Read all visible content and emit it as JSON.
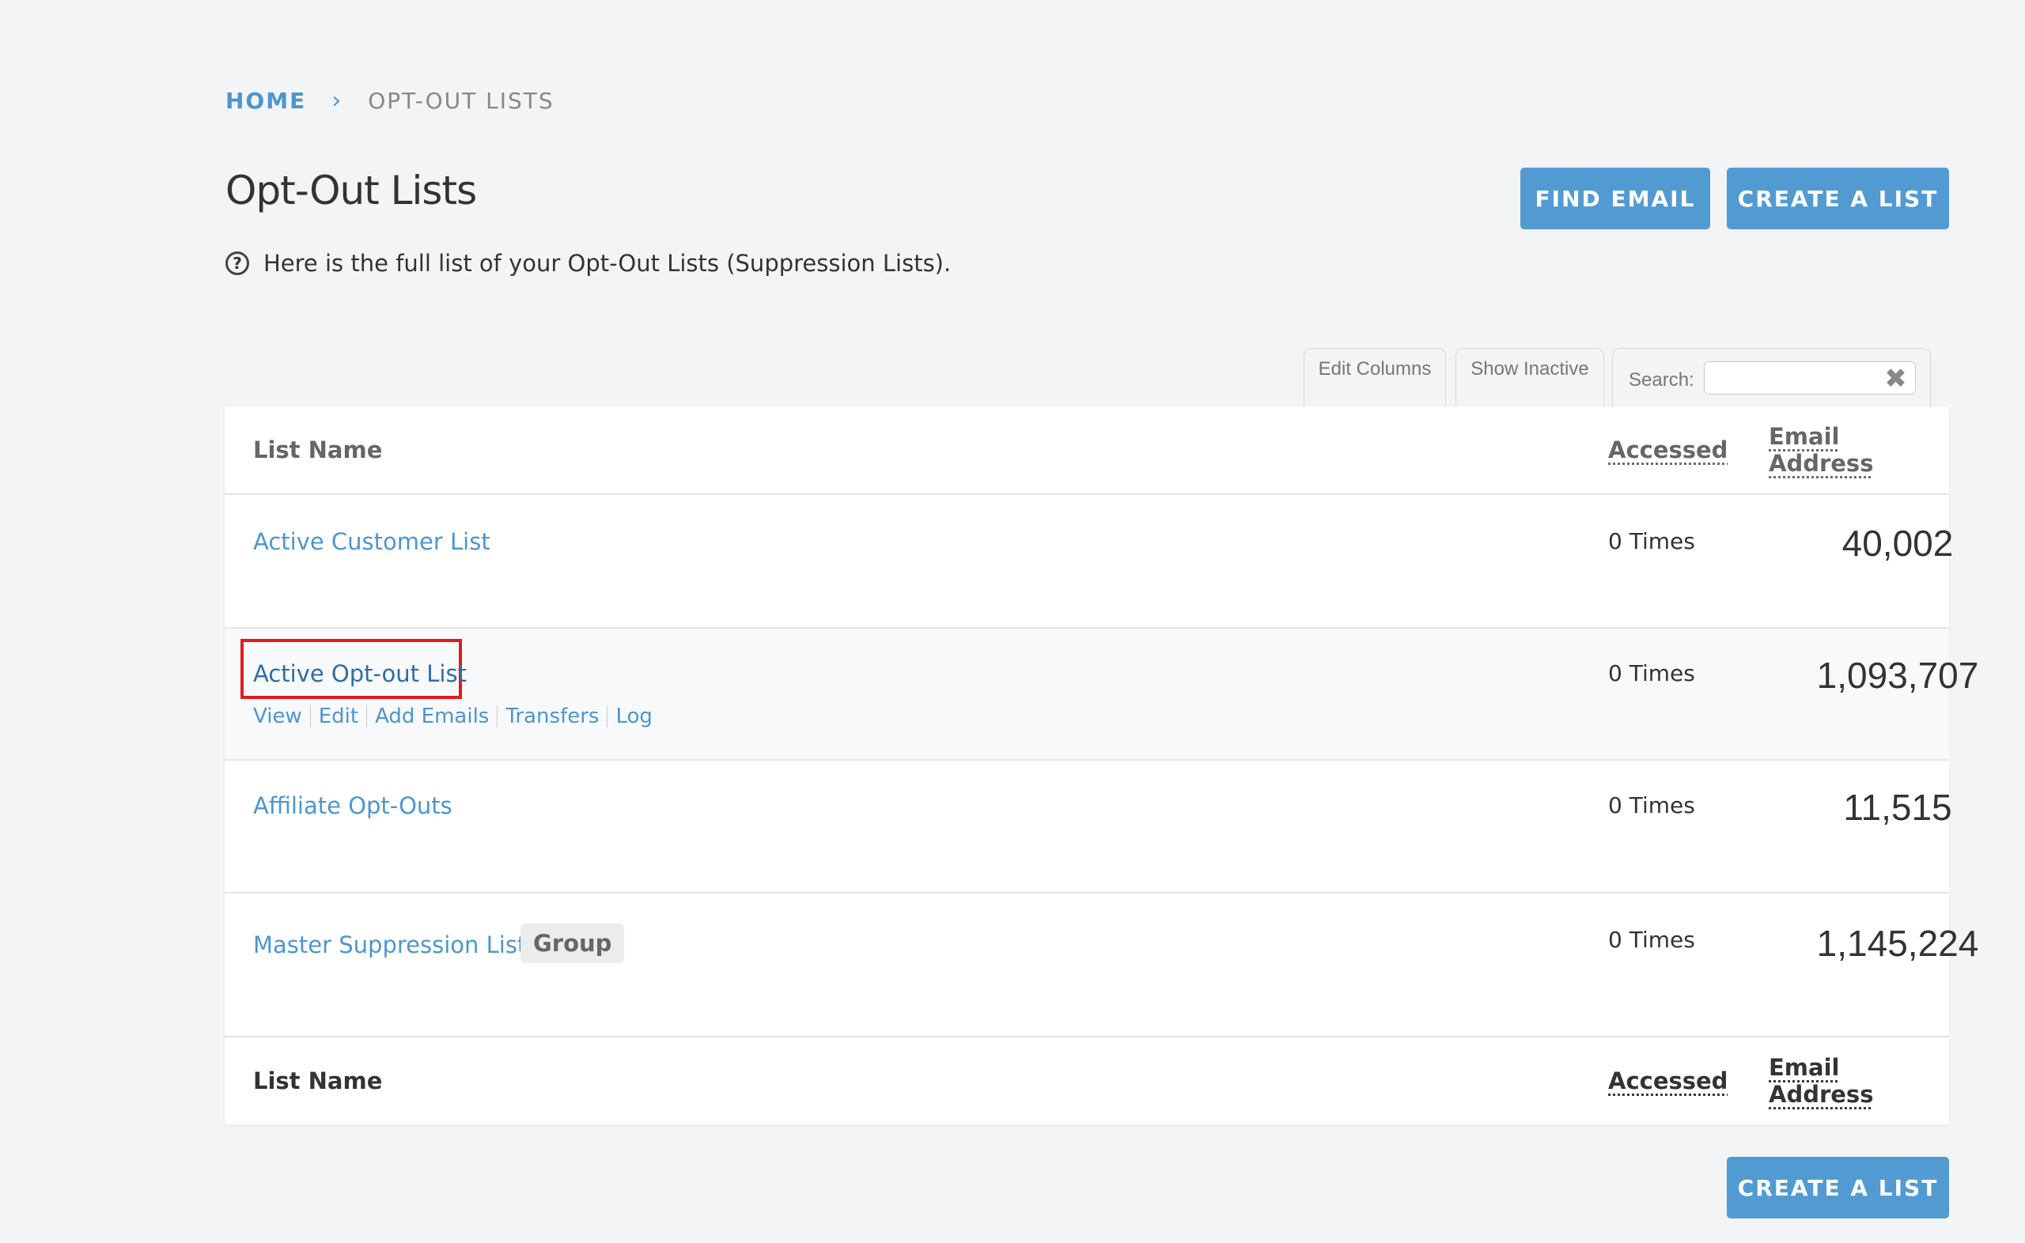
{
  "breadcrumb": {
    "home": "HOME",
    "separator": "›",
    "current": "OPT-OUT LISTS"
  },
  "page": {
    "title": "Opt-Out Lists",
    "description": "Here is the full list of your Opt-Out Lists (Suppression Lists).",
    "help_icon": "?"
  },
  "buttons": {
    "find_email": "FIND EMAIL",
    "create_list": "CREATE A LIST"
  },
  "toolbar": {
    "edit_columns": "Edit Columns",
    "show_inactive": "Show Inactive",
    "search_label": "Search:",
    "search_value": "",
    "clear_icon": "✖"
  },
  "table": {
    "headers": {
      "name": "List Name",
      "accessed": "Accessed",
      "email": "Email Address"
    },
    "rows": [
      {
        "name": "Active Customer List",
        "accessed": "0 Times",
        "email_count": "40,002"
      },
      {
        "name": "Active Opt-out List",
        "accessed": "0 Times",
        "email_count": "1,093,707",
        "actions": [
          "View",
          "Edit",
          "Add Emails",
          "Transfers",
          "Log"
        ]
      },
      {
        "name": "Affiliate Opt-Outs",
        "accessed": "0 Times",
        "email_count": "11,515"
      },
      {
        "name": "Master Suppression List",
        "badge": "Group",
        "accessed": "0 Times",
        "email_count": "1,145,224"
      }
    ]
  },
  "colors": {
    "accent": "#529bd2",
    "link": "#4d96ce",
    "highlight": "#e01b1b"
  }
}
